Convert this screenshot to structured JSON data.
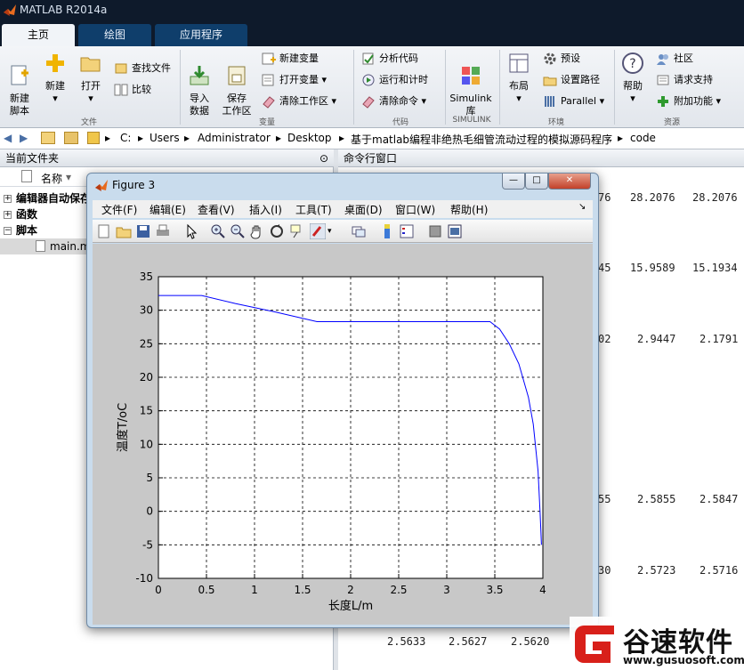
{
  "app": {
    "title": "MATLAB R2014a"
  },
  "tabs": [
    {
      "label": "主页"
    },
    {
      "label": "绘图"
    },
    {
      "label": "应用程序"
    }
  ],
  "ribbon": {
    "file": {
      "new_script": "新建\n脚本",
      "new": "新建",
      "open": "打开",
      "find_files": "查找文件",
      "compare": "比较",
      "group": "文件"
    },
    "variable": {
      "import": "导入\n数据",
      "save_ws": "保存\n工作区",
      "new_var": "新建变量",
      "open_var": "打开变量",
      "clear_ws": "清除工作区",
      "group": "变量"
    },
    "code": {
      "analyze": "分析代码",
      "run_time": "运行和计时",
      "clear_cmd": "清除命令",
      "group": "代码"
    },
    "simulink": {
      "lib": "Simulink\n库",
      "group": "SIMULINK"
    },
    "env": {
      "layout": "布局",
      "prefs": "预设",
      "set_path": "设置路径",
      "parallel": "Parallel",
      "group": "环境"
    },
    "resources": {
      "help": "帮助",
      "community": "社区",
      "request_support": "请求支持",
      "addons": "附加功能",
      "group": "资源"
    }
  },
  "address": {
    "parts": [
      "C:",
      "Users",
      "Administrator",
      "Desktop",
      "基于matlab编程非绝热毛细管流动过程的模拟源码程序",
      "code"
    ]
  },
  "current_folder": {
    "title": "当前文件夹",
    "col_name": "名称",
    "items": [
      {
        "label": "编辑器自动保存"
      },
      {
        "label": "函数"
      },
      {
        "label": "脚本"
      }
    ],
    "file": "main.m"
  },
  "command_window": {
    "title": "命令行窗口",
    "rows": [
      [
        "76",
        "28.2076",
        "28.2076"
      ],
      [
        "45",
        "15.9589",
        "15.1934"
      ],
      [
        "02",
        "2.9447",
        "2.1791"
      ],
      [
        "55",
        "2.5855",
        "2.5847"
      ],
      [
        "30",
        "2.5723",
        "2.5716"
      ],
      [
        "2.5633",
        "2.5627",
        "2.5620"
      ]
    ]
  },
  "figure": {
    "title": "Figure 3",
    "menus": [
      "文件(F)",
      "编辑(E)",
      "查看(V)",
      "插入(I)",
      "工具(T)",
      "桌面(D)",
      "窗口(W)",
      "帮助(H)"
    ]
  },
  "chart_data": {
    "type": "line",
    "xlabel": "长度L/m",
    "ylabel": "温度T/oC",
    "xlim": [
      0,
      4
    ],
    "ylim": [
      -10,
      35
    ],
    "xticks": [
      0,
      0.5,
      1,
      1.5,
      2,
      2.5,
      3,
      3.5,
      4
    ],
    "yticks": [
      -10,
      -5,
      0,
      5,
      10,
      15,
      20,
      25,
      30,
      35
    ],
    "grid": true,
    "colors": {
      "line": "#0000ff"
    },
    "series": [
      {
        "x": [
          0,
          0.45,
          0.8,
          1.2,
          1.65,
          2.5,
          3.0,
          3.45,
          3.55,
          3.65,
          3.75,
          3.85,
          3.9,
          3.95,
          3.97,
          3.98,
          3.985
        ],
        "y": [
          32.2,
          32.2,
          31.0,
          29.8,
          28.3,
          28.3,
          28.3,
          28.3,
          27.2,
          25.0,
          22.0,
          17.0,
          13.0,
          6.0,
          0.0,
          -3.0,
          -5.0
        ]
      }
    ]
  },
  "watermark": {
    "brand": "谷速软件",
    "url": "www.gusuosoft.com"
  }
}
